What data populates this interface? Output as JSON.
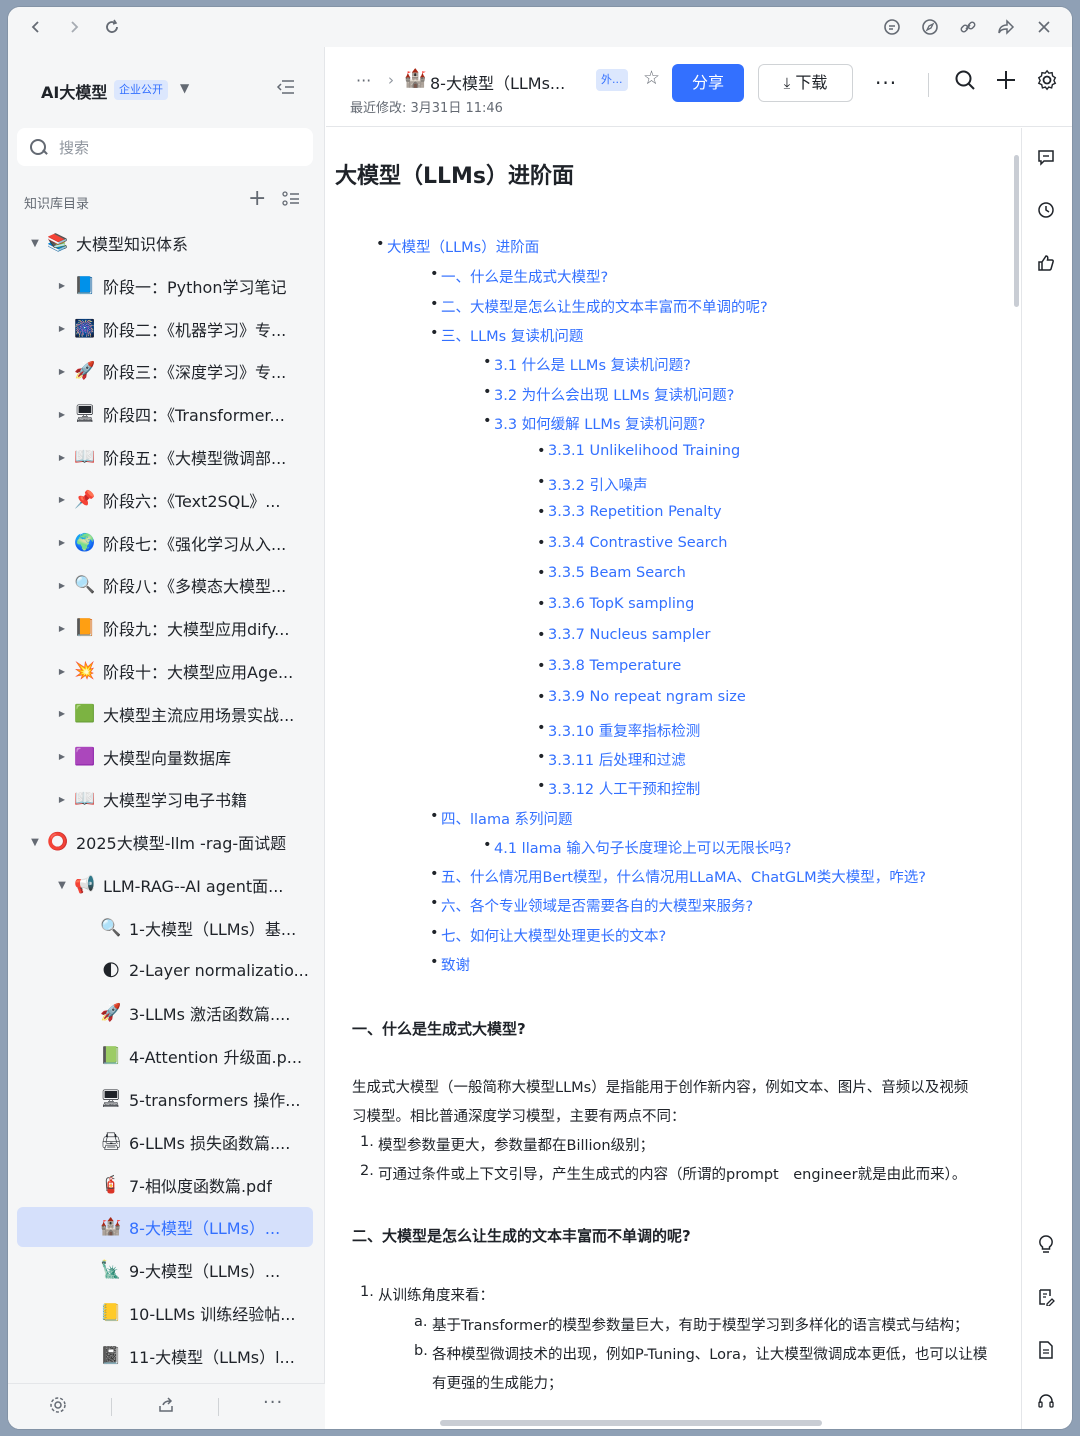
{
  "sidebar": {
    "workspace_title": "AI大模型",
    "workspace_badge": "企业公开",
    "search_placeholder": "搜索",
    "directory_label": "知识库目录",
    "tree": [
      {
        "label": "大模型知识体系",
        "icon": "📚",
        "level": 0,
        "expanded": true
      },
      {
        "label": "阶段一：Python学习笔记",
        "icon": "📘",
        "level": 1
      },
      {
        "label": "阶段二：《机器学习》专...",
        "icon": "🎆",
        "level": 1
      },
      {
        "label": "阶段三：《深度学习》专...",
        "icon": "🚀",
        "level": 1
      },
      {
        "label": "阶段四：《Transformer...",
        "icon": "🖥",
        "level": 1
      },
      {
        "label": "阶段五：《大模型微调部...",
        "icon": "📖",
        "level": 1
      },
      {
        "label": "阶段六：《Text2SQL》...",
        "icon": "📌",
        "level": 1
      },
      {
        "label": "阶段七：《强化学习从入...",
        "icon": "🌍",
        "level": 1
      },
      {
        "label": "阶段八：《多模态大模型...",
        "icon": "🔍",
        "level": 1
      },
      {
        "label": "阶段九：大模型应用dify...",
        "icon": "📙",
        "level": 1
      },
      {
        "label": "阶段十：大模型应用Age...",
        "icon": "💥",
        "level": 1
      },
      {
        "label": "大模型主流应用场景实战...",
        "icon": "🟩",
        "level": 1
      },
      {
        "label": "大模型向量数据库",
        "icon": "🟪",
        "level": 1
      },
      {
        "label": "大模型学习电子书籍",
        "icon": "📖",
        "level": 1
      },
      {
        "label": "2025大模型-llm -rag-面试题",
        "icon": "⭕",
        "level": 0,
        "expanded": true
      },
      {
        "label": "LLM-RAG--AI agent面...",
        "icon": "📢",
        "level": 1,
        "expanded": true
      },
      {
        "label": "1-大模型（LLMs）基...",
        "icon": "🔍",
        "level": 2
      },
      {
        "label": "2-Layer normalizatio...",
        "icon": "🌓",
        "level": 2
      },
      {
        "label": "3-LLMs 激活函数篇....",
        "icon": "🚀",
        "level": 2
      },
      {
        "label": "4-Attention 升级面.p...",
        "icon": "📗",
        "level": 2
      },
      {
        "label": "5-transformers 操作...",
        "icon": "🖥",
        "level": 2
      },
      {
        "label": "6-LLMs 损失函数篇....",
        "icon": "🖨",
        "level": 2
      },
      {
        "label": "7-相似度函数篇.pdf",
        "icon": "🧯",
        "level": 2
      },
      {
        "label": "8-大模型（LLMs）...",
        "icon": "🏰",
        "level": 2,
        "active": true
      },
      {
        "label": "9-大模型（LLMs）...",
        "icon": "🗽",
        "level": 2
      },
      {
        "label": "10-LLMs 训练经验帖...",
        "icon": "📒",
        "level": 2
      },
      {
        "label": "11-大模型（LLMs）l...",
        "icon": "📓",
        "level": 2
      }
    ]
  },
  "header": {
    "breadcrumb_more": "···",
    "doc_icon": "🏰",
    "doc_title": "8-大模型（LLMs...",
    "external_badge": "外...",
    "last_modified": "最近修改: 3月31日 11:46",
    "share_label": "分享",
    "download_label": "下载"
  },
  "document": {
    "title": "大模型（LLMs）进阶面",
    "toc": [
      {
        "text": "大模型（LLMs）进阶面",
        "level": 0
      },
      {
        "text": "一、什么是生成式大模型?",
        "level": 1
      },
      {
        "text": "二、大模型是怎么让生成的文本丰富而不单调的呢?",
        "level": 1
      },
      {
        "text": "三、LLMs 复读机问题",
        "level": 1
      },
      {
        "text": "3.1 什么是 LLMs 复读机问题?",
        "level": 2
      },
      {
        "text": "3.2 为什么会出现 LLMs 复读机问题?",
        "level": 2
      },
      {
        "text": "3.3 如何缓解 LLMs 复读机问题?",
        "level": 2
      },
      {
        "text": "3.3.1 Unlikelihood Training",
        "level": 3
      },
      {
        "text": "3.3.2 引入噪声",
        "level": 3
      },
      {
        "text": "3.3.3 Repetition Penalty",
        "level": 3
      },
      {
        "text": "3.3.4 Contrastive Search",
        "level": 3
      },
      {
        "text": "3.3.5 Beam Search",
        "level": 3
      },
      {
        "text": "3.3.6 TopK sampling",
        "level": 3
      },
      {
        "text": "3.3.7 Nucleus sampler",
        "level": 3
      },
      {
        "text": "3.3.8 Temperature",
        "level": 3
      },
      {
        "text": "3.3.9 No repeat ngram size",
        "level": 3
      },
      {
        "text": "3.3.10 重复率指标检测",
        "level": 3
      },
      {
        "text": "3.3.11 后处理和过滤",
        "level": 3
      },
      {
        "text": "3.3.12 人工干预和控制",
        "level": 3
      },
      {
        "text": "四、llama 系列问题",
        "level": 1
      },
      {
        "text": "4.1 llama 输入句子长度理论上可以无限长吗?",
        "level": 2
      },
      {
        "text": "五、什么情况用Bert模型，什么情况用LLaMA、ChatGLM类大模型，咋选?",
        "level": 1
      },
      {
        "text": "六、各个专业领域是否需要各自的大模型来服务?",
        "level": 1
      },
      {
        "text": "七、如何让大模型处理更长的文本?",
        "level": 1
      },
      {
        "text": "致谢",
        "level": 1
      }
    ],
    "section1_heading": "一、什么是生成式大模型?",
    "section1_para_line1": "生成式大模型（一般简称大模型LLMs）是指能用于创作新内容，例如文本、图片、音频以及视频",
    "section1_para_line2": "习模型。相比普通深度学习模型，主要有两点不同：",
    "section1_list": [
      {
        "num": "1.",
        "text": "模型参数量更大，参数量都在Billion级别；"
      },
      {
        "num": "2.",
        "text": "可通过条件或上下文引导，产生生成式的内容（所谓的prompt　engineer就是由此而来）。"
      }
    ],
    "section2_heading": "二、大模型是怎么让生成的文本丰富而不单调的呢?",
    "section2_list_num": "1.",
    "section2_list_text": "从训练角度来看：",
    "section2_sub": [
      {
        "num": "a.",
        "text": "基于Transformer的模型参数量巨大，有助于模型学习到多样化的语言模式与结构；"
      },
      {
        "num": "b.",
        "text": "各种模型微调技术的出现，例如P-Tuning、Lora，让大模型微调成本更低，也可以让模"
      }
    ],
    "section2_sub_cont": "有更强的生成能力；"
  }
}
